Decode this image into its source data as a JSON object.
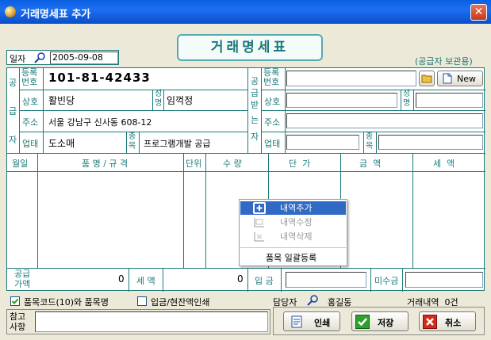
{
  "window": {
    "title": "거래명세표 추가",
    "close_glyph": "✕"
  },
  "header": {
    "date_label": "일자",
    "date_value": "2005-09-08",
    "doc_title": "거래명세표",
    "copy_note": "(공급자 보관용)"
  },
  "supplier": {
    "side_chars": [
      "공",
      "급",
      "자"
    ],
    "reg_label": "등록\n번호",
    "reg_no": "101-81-42433",
    "company_label": "상호",
    "company": "활빈당",
    "name_label": "성\n명",
    "name": "임꺽정",
    "addr_label": "주소",
    "address": "서울 강남구 신사동 608-12",
    "biz_label": "업태",
    "biz_type": "도소매",
    "item_label": "종\n목",
    "item": "프로그램개발 공급"
  },
  "receiver": {
    "side_chars": [
      "공",
      "급",
      "받",
      "는",
      "자"
    ],
    "reg_label": "등록\n번호",
    "company_label": "상호",
    "name_label": "성\n명",
    "addr_label": "주소",
    "biz_label": "업태",
    "item_label": "종\n목",
    "new_button": "New"
  },
  "table": {
    "columns": [
      "월일",
      "품 명 / 규 격",
      "단위",
      "수 량",
      "단  가",
      "금  액",
      "세  액"
    ]
  },
  "context_menu": {
    "items": [
      {
        "label": "내역추가",
        "enabled": true,
        "icon": "plus-icon"
      },
      {
        "label": "내역수정",
        "enabled": false,
        "icon": "edit-icon"
      },
      {
        "label": "내역삭제",
        "enabled": false,
        "icon": "delete-icon"
      }
    ],
    "footer": "품목 일괄등록"
  },
  "totals": {
    "supply_label": "공급\n가액",
    "supply_value": "0",
    "tax_label": "세 액",
    "tax_value": "0",
    "paid_label": "입 금",
    "unpaid_label": "미수금"
  },
  "options": {
    "item_code_label": "품목코드(10)와 품목명",
    "item_code_checked": true,
    "print_label": "입금/현잔액인쇄",
    "print_checked": false,
    "staff_label": "담당자",
    "staff_name": "홍길동",
    "count_text": "거래내역  0건"
  },
  "footer": {
    "memo_label": "참고\n사항",
    "print_btn": "인쇄",
    "save_btn": "저장",
    "cancel_btn": "취소"
  },
  "colors": {
    "accent": "#1b7a7a",
    "titlebar": "#0a5fe0",
    "menu_highlight": "#316ac5"
  }
}
